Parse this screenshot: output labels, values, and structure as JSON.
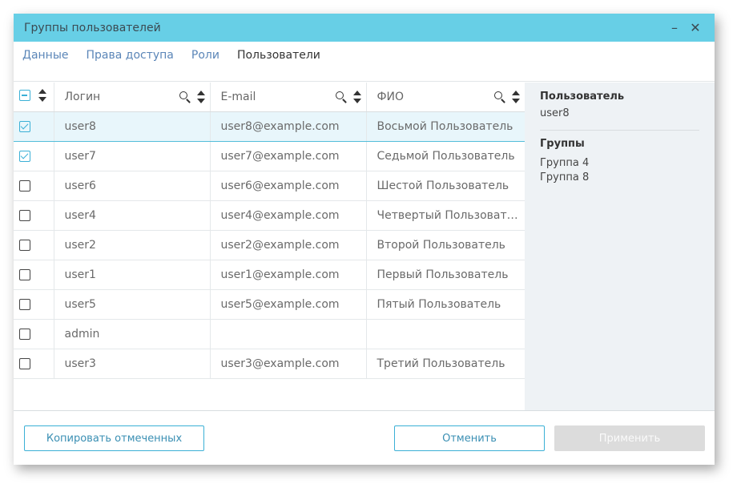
{
  "window": {
    "title": "Группы пользователей",
    "minimize_glyph": "–",
    "close_glyph": "✕"
  },
  "tabs": [
    {
      "label": "Данные",
      "active": false
    },
    {
      "label": "Права доступа",
      "active": false
    },
    {
      "label": "Роли",
      "active": false
    },
    {
      "label": "Пользователи",
      "active": true
    }
  ],
  "table": {
    "columns": [
      "Логин",
      "E-mail",
      "ФИО"
    ],
    "rows": [
      {
        "login": "user8",
        "email": "user8@example.com",
        "fio": "Восьмой Пользователь",
        "checked": true,
        "selected": true
      },
      {
        "login": "user7",
        "email": "user7@example.com",
        "fio": "Седьмой Пользователь",
        "checked": true,
        "selected": false
      },
      {
        "login": "user6",
        "email": "user6@example.com",
        "fio": "Шестой Пользователь",
        "checked": false,
        "selected": false
      },
      {
        "login": "user4",
        "email": "user4@example.com",
        "fio": "Четвертый Пользователь",
        "checked": false,
        "selected": false
      },
      {
        "login": "user2",
        "email": "user2@example.com",
        "fio": "Второй Пользователь",
        "checked": false,
        "selected": false
      },
      {
        "login": "user1",
        "email": "user1@example.com",
        "fio": "Первый Пользователь",
        "checked": false,
        "selected": false
      },
      {
        "login": "user5",
        "email": "user5@example.com",
        "fio": "Пятый Пользователь",
        "checked": false,
        "selected": false
      },
      {
        "login": "admin",
        "email": "",
        "fio": "",
        "checked": false,
        "selected": false
      },
      {
        "login": "user3",
        "email": "user3@example.com",
        "fio": "Третий Пользователь",
        "checked": false,
        "selected": false
      }
    ]
  },
  "side": {
    "user_label": "Пользователь",
    "user_value": "user8",
    "groups_label": "Группы",
    "groups": [
      "Группа 4",
      "Группа 8"
    ]
  },
  "footer": {
    "copy_label": "Копировать отмеченных",
    "cancel_label": "Отменить",
    "apply_label": "Применить"
  },
  "colors": {
    "titlebar": "#67cfe6",
    "accent": "#3bb0d6",
    "selected_row": "#e8f6fb",
    "side_panel": "#eef2f5"
  }
}
